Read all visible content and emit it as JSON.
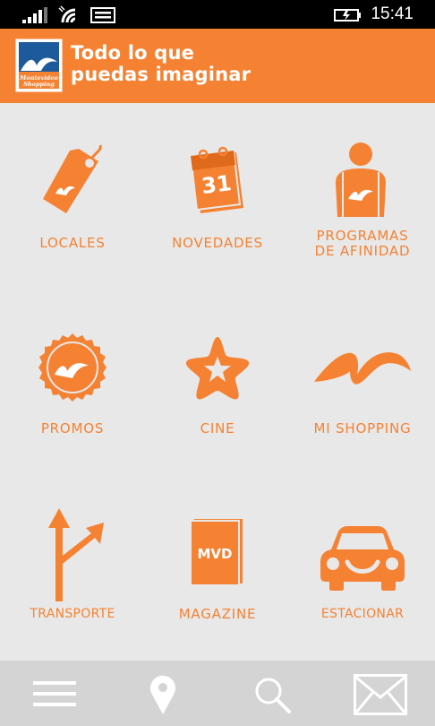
{
  "status_bar": {
    "time": "15:41",
    "icons": [
      "signal-bars-icon",
      "wifi-icon",
      "message-icon",
      "battery-charging-icon"
    ]
  },
  "header": {
    "logo_text": "Montevideo Shopping",
    "title_line1": "Todo lo que",
    "title_line2": "puedas imaginar",
    "accent_color": "#f58233"
  },
  "tiles": [
    {
      "label": "LOCALES",
      "icon": "price-tag-icon"
    },
    {
      "label": "NOVEDADES",
      "icon": "calendar-icon",
      "icon_text": "31"
    },
    {
      "label_line1": "PROGRAMAS",
      "label_line2": "DE AFINIDAD",
      "icon": "person-icon"
    },
    {
      "label": "PROMOS",
      "icon": "badge-icon"
    },
    {
      "label": "CINE",
      "icon": "star-icon"
    },
    {
      "label": "MI SHOPPING",
      "icon": "wave-logo-icon"
    },
    {
      "label": "TRANSPORTE",
      "icon": "direction-arrows-icon"
    },
    {
      "label": "MAGAZINE",
      "icon": "magazine-icon",
      "icon_text": "MVD"
    },
    {
      "label": "ESTACIONAR",
      "icon": "car-icon"
    }
  ],
  "app_bar": {
    "buttons": [
      "menu-icon",
      "location-pin-icon",
      "search-icon",
      "mail-icon"
    ]
  }
}
